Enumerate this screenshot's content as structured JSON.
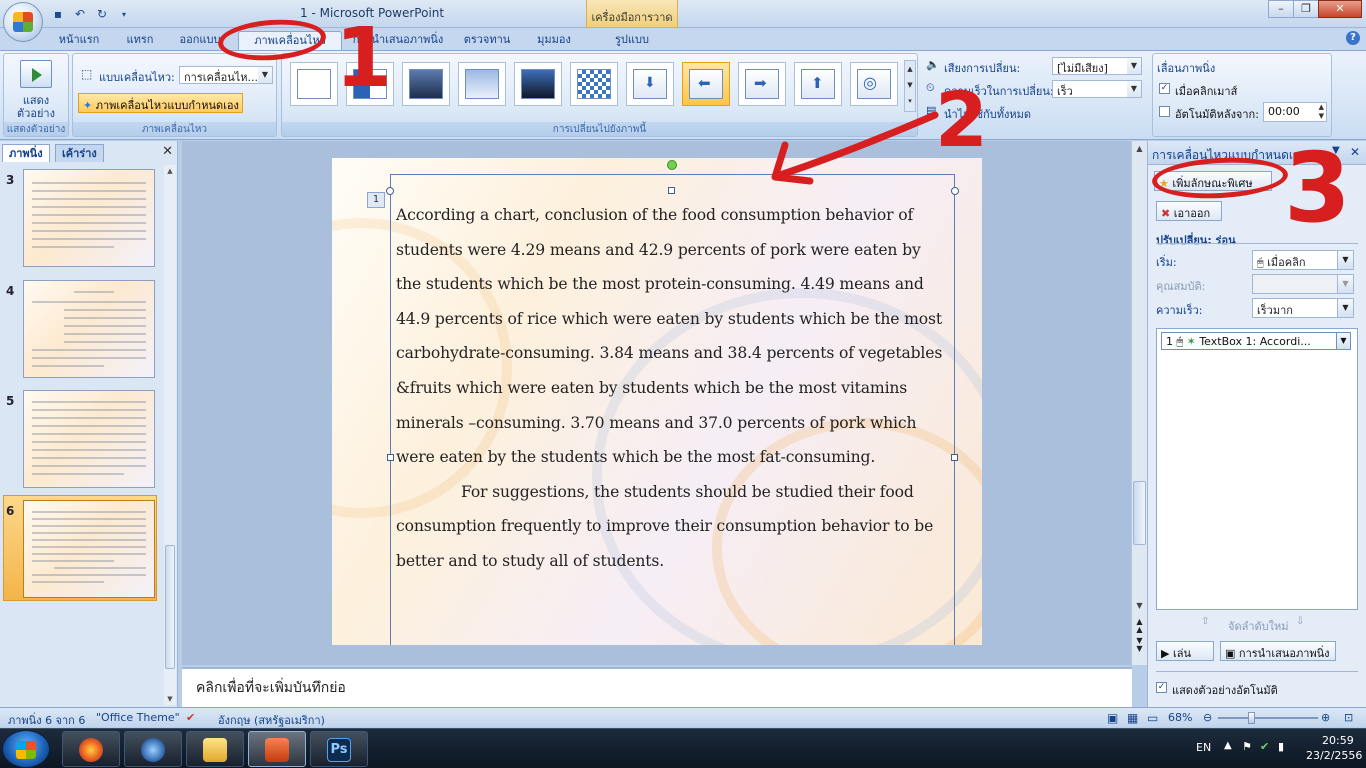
{
  "window": {
    "title": "1 - Microsoft PowerPoint",
    "context_tools": "เครื่องมือการวาด"
  },
  "tabs": [
    {
      "label": "หน้าแรก"
    },
    {
      "label": "แทรก"
    },
    {
      "label": "ออกแบบ"
    },
    {
      "label": "ภาพเคลื่อนไหว"
    },
    {
      "label": "การนำเสนอภาพนิ่ง"
    },
    {
      "label": "ตรวจทาน"
    },
    {
      "label": "มุมมอง"
    },
    {
      "label": "รูปแบบ"
    }
  ],
  "ribbon": {
    "preview": {
      "button_label": "แสดงตัวอย่าง",
      "group_label": "แสดงตัวอย่าง"
    },
    "animations": {
      "anim_label": "แบบเคลื่อนไหว:",
      "anim_value": "การเคลื่อนไห...",
      "custom_button": "ภาพเคลื่อนไหวแบบกำหนดเอง",
      "group_label": "ภาพเคลื่อนไหว"
    },
    "transitions": {
      "group_label": "การเปลี่ยนไปยังภาพนี้",
      "sound_label": "เสียงการเปลี่ยน:",
      "sound_value": "[ไม่มีเสียง]",
      "speed_label": "ความเร็วในการเปลี่ยน:",
      "speed_value": "เร็ว",
      "apply_all": "นำไปใช้กับทั้งหมด"
    },
    "advance": {
      "title": "เลื่อนภาพนิ่ง",
      "on_click": "เมื่อคลิกเมาส์",
      "auto_after": "อัตโนมัติหลังจาก:",
      "time_value": "00:00"
    }
  },
  "left_panel": {
    "tab_slides": "ภาพนิ่ง",
    "tab_outline": "เค้าร่าง",
    "thumbnails": [
      {
        "num": "3"
      },
      {
        "num": "4"
      },
      {
        "num": "5"
      },
      {
        "num": "6",
        "active": true
      }
    ]
  },
  "slide": {
    "anim_badge": "1",
    "paragraph1": "According a chart, conclusion of the food consumption behavior of students were 4.29 means and 42.9 percents of pork were eaten  by the students which be the most protein-consuming.  4.49 means and 44.9 percents of rice which were eaten by students which be the most carbohydrate-consuming. 3.84 means and 38.4 percents of vegetables &fruits which were eaten by students which be the most vitamins minerals –consuming. 3.70 means and 37.0 percents of pork  which were eaten by the students which be the most fat-consuming.",
    "paragraph2": "For  suggestions, the students should be studied their food consumption frequently to improve their consumption behavior to be better and to study all of students."
  },
  "notes": {
    "placeholder": "คลิกเพื่อที่จะเพิ่มบันทึกย่อ"
  },
  "custom_animation": {
    "title": "การเคลื่อนไหวแบบกำหนดเอง",
    "add_effect": "เพิ่มลักษณะพิเศษ",
    "remove": "เอาออก",
    "modify_title": "ปรับเปลี่ยน: ร่อน",
    "start_label": "เริ่ม:",
    "start_value": "เมื่อคลิก",
    "property_label": "คุณสมบัติ:",
    "speed_label": "ความเร็ว:",
    "speed_value": "เร็วมาก",
    "list_item_num": "1",
    "list_item_text": "TextBox 1: Accordi...",
    "reorder": "จัดลำดับใหม่",
    "play": "เล่น",
    "slideshow": "การนำเสนอภาพนิ่ง",
    "autopreview": "แสดงตัวอย่างอัตโนมัติ"
  },
  "status": {
    "slide_pos": "ภาพนิ่ง 6 จาก 6",
    "theme": "\"Office Theme\"",
    "language": "อังกฤษ (สหรัฐอเมริกา)",
    "zoom": "68%"
  },
  "taskbar": {
    "lang": "EN",
    "time": "20:59",
    "date": "23/2/2556",
    "ps_label": "Ps"
  },
  "annotations": {
    "one": "1",
    "two": "2",
    "three": "3"
  },
  "colors": {
    "ribbon_bg": "#d8e6f6",
    "accent_selected": "#ffc447",
    "annotation_red": "#d81f1f"
  }
}
